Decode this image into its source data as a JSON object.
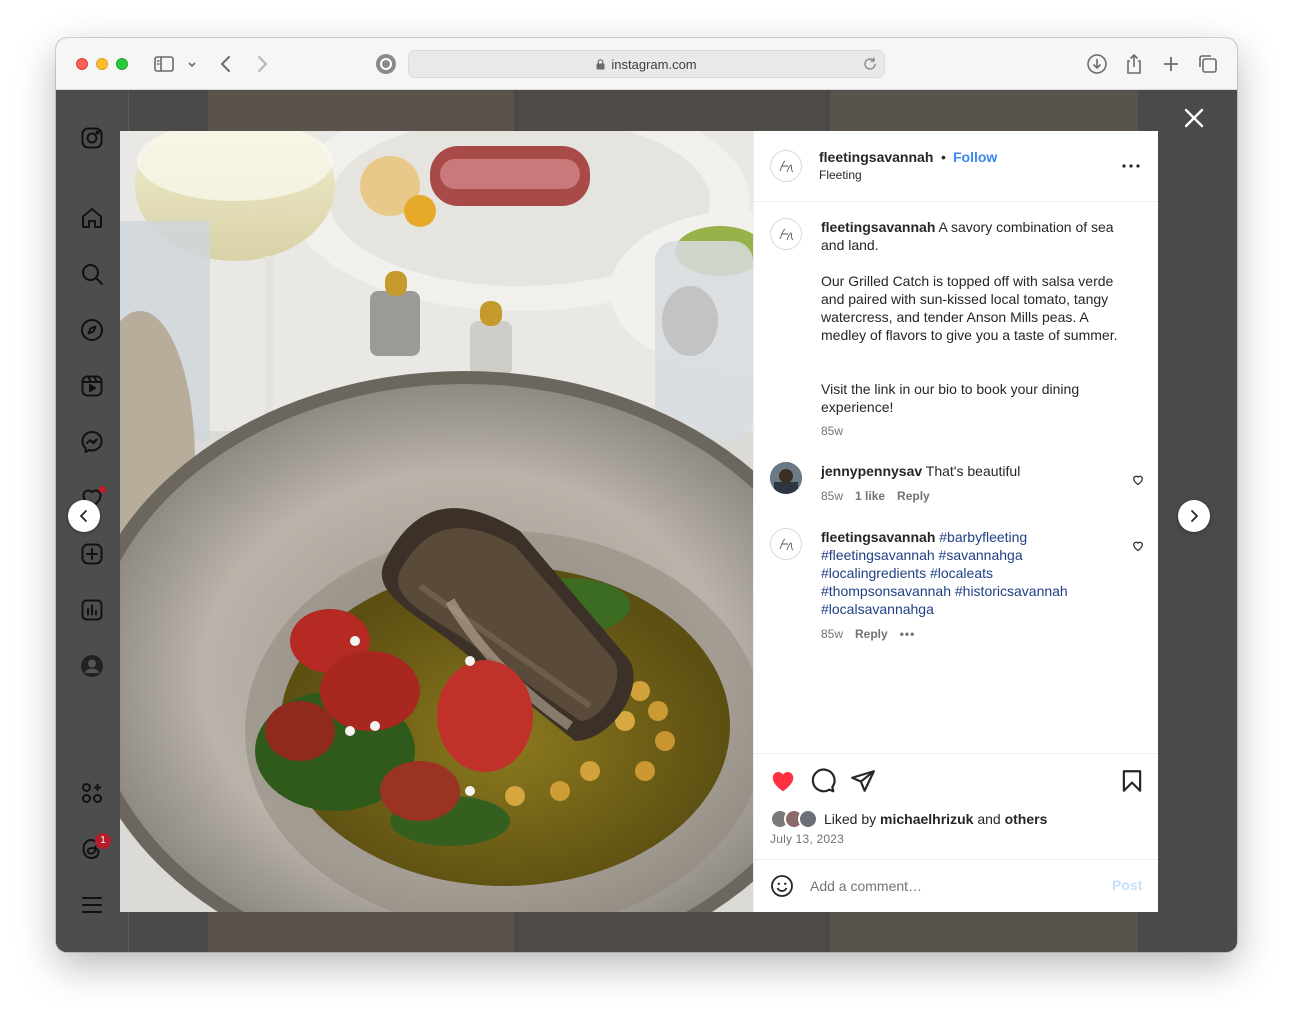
{
  "browser": {
    "url": "instagram.com"
  },
  "post": {
    "username": "fleetingsavannah",
    "follow_label": "Follow",
    "location": "Fleeting",
    "caption_username": "fleetingsavannah",
    "caption_p1": "A savory combination of sea and land.",
    "caption_p2": "Our Grilled Catch is topped off with salsa verde and paired with sun-kissed local tomato, tangy watercress, and tender Anson Mills peas. A medley of flavors to give you a taste of summer.",
    "caption_p3": "Visit the link in our bio to book your dining experience!",
    "caption_time": "85w",
    "comments": [
      {
        "username": "jennypennysav",
        "text": "That's beautiful",
        "time": "85w",
        "likes": "1 like",
        "reply": "Reply"
      },
      {
        "username": "fleetingsavannah",
        "hashtags": "#barbyfleeting #fleetingsavannah #savannahga #localingredients #localeats #thompsonsavannah #historicsavannah #localsavannahga",
        "time": "85w",
        "reply": "Reply"
      }
    ],
    "liked_prefix": "Liked by",
    "liked_user": "michaelhrizuk",
    "liked_and": "and",
    "liked_others": "others",
    "date": "July 13, 2023",
    "comment_placeholder": "Add a comment…",
    "post_label": "Post"
  },
  "sidebar": {
    "notification_badge": "1"
  },
  "icons": {
    "toolbar": [
      "sidebar-icon",
      "chevron-down-icon",
      "back-icon",
      "forward-icon",
      "site-icon",
      "download-icon",
      "share-icon",
      "new-tab-icon",
      "tabs-overview-icon"
    ],
    "sidebar": [
      "instagram-icon",
      "home-icon",
      "search-icon",
      "explore-icon",
      "reels-icon",
      "messenger-icon",
      "heart-icon",
      "create-icon",
      "dashboard-icon",
      "profile-icon",
      "also-from-meta-icon",
      "threads-icon",
      "menu-icon"
    ]
  },
  "colors": {
    "like_red": "#ff3040",
    "follow_blue": "#3a87f0",
    "hashtag_navy": "#1f3f85",
    "post_disabled": "#c5dffc"
  }
}
